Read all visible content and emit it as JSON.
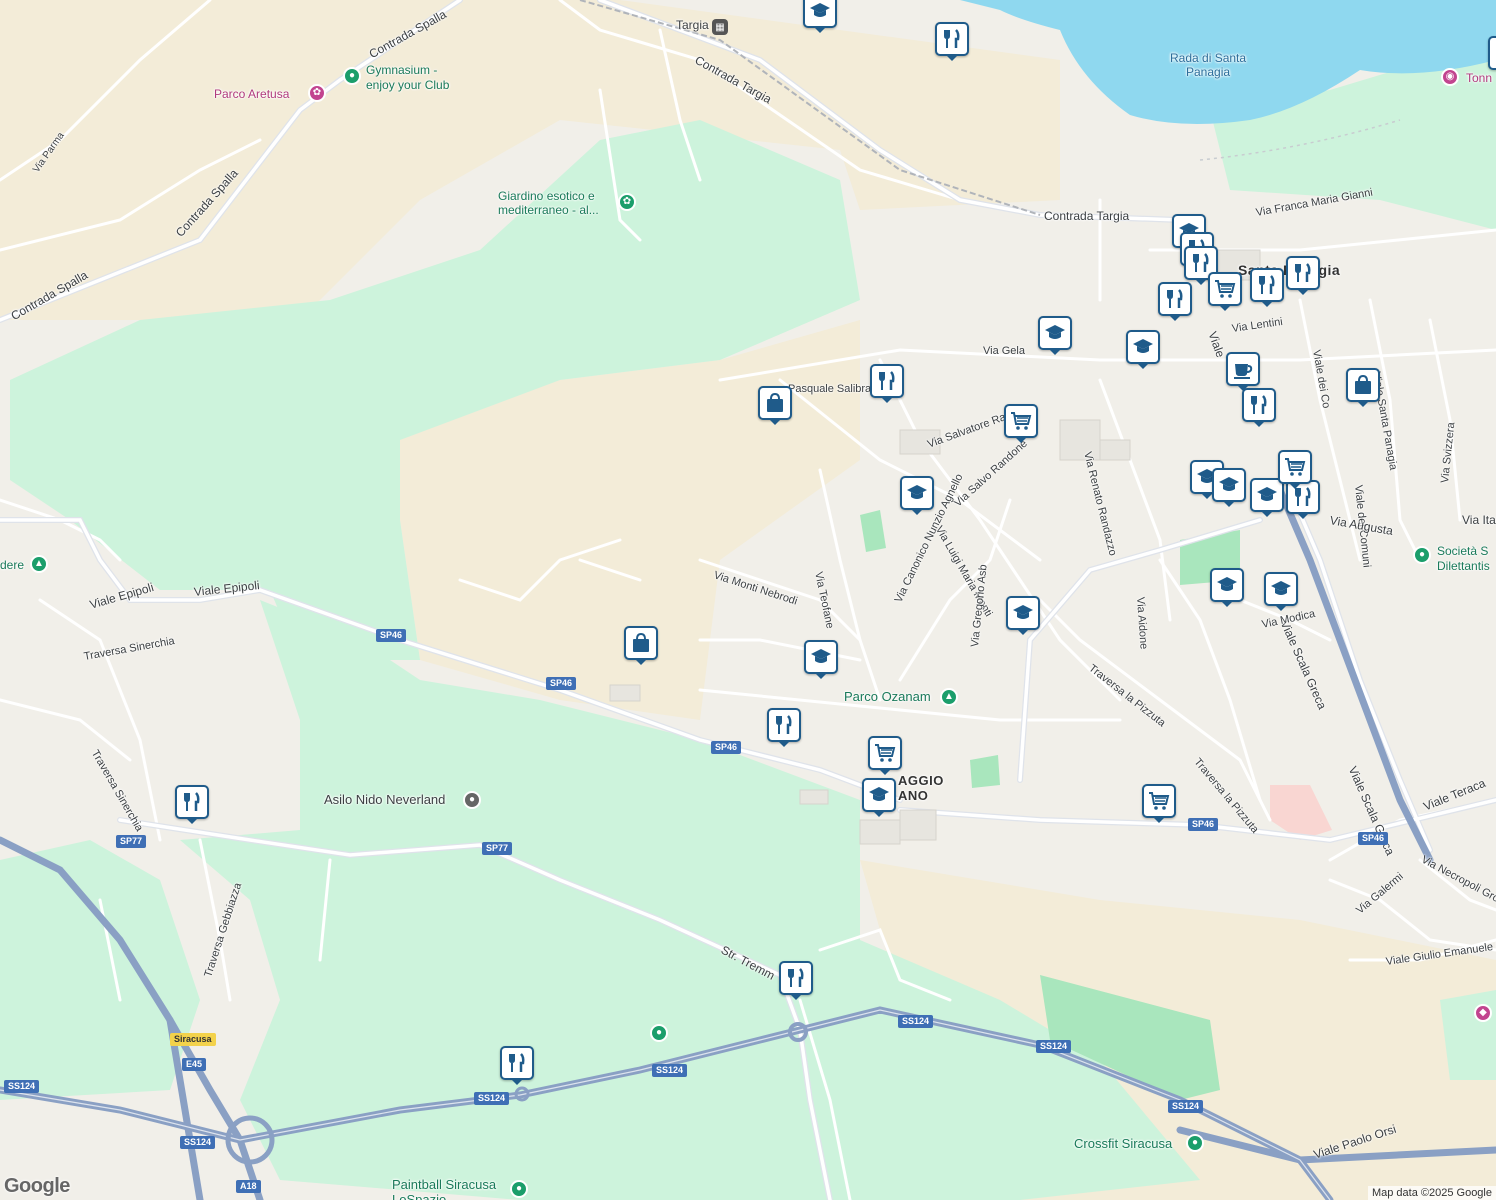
{
  "map": {
    "labels": {
      "parco_aretusa": "Parco Aretusa",
      "gymnasium": "Gymnasium -\nenjoy your Club",
      "contrada_spalla_1": "Contrada Spalla",
      "contrada_spalla_2": "Contrada Spalla",
      "contrada_spalla_3": "Contrada Spalla",
      "via_parma": "Via Parma",
      "targia": "Targia",
      "contrada_targia_1": "Contrada Targia",
      "contrada_targia_2": "Contrada Targia",
      "rada": "Rada di Santa\nPanagia",
      "tonn": "Tonn",
      "giardino": "Giardino esotico e\nmediterraneo - al...",
      "via_franca": "Via Franca Maria Gianni",
      "santa_panagia": "Santa Panagia",
      "via_lentini": "Via Lentini",
      "via_gela": "Via Gela",
      "viale_short": "Viale",
      "via_pasquale": "Pasquale Salibra",
      "via_salvatore": "Via Salvatore Ra",
      "via_salvo": "Via Salvo Randone",
      "via_renato": "Via Renato Randazzo",
      "viale_dei_co": "Viale dei Co",
      "viale_santa_panagia": "Viale Santa Panagia",
      "viale_dei_comuni": "Viale dei Comuni",
      "via_svizzera": "Via Svizzera",
      "via_ita": "Via Ita",
      "via_augusta": "Via Augusta",
      "societa": "Società S\nDilettantis",
      "via_luigi": "Via Luigi Maria Monti",
      "via_teofane": "Via Teofane",
      "via_monti_nebrodi": "Via Monti Nebrodi",
      "via_canonico": "Via Canonico Nunzio Agnello",
      "via_gregorio": "Via Gregorio Asb",
      "via_aidone": "Via Aidone",
      "viale_scala_greca_1": "Viale Scala Greca",
      "viale_scala_greca_2": "Viale Scala Greca",
      "via_modica": "Via Modica",
      "traversa_pizzuta_1": "Traversa la Pizzuta",
      "traversa_pizzuta_2": "Traversa la Pizzuta",
      "parco_ozanam": "Parco Ozanam",
      "villaggio": "AGGIO\nANO",
      "viale_teracati": "Viale Teraca",
      "via_necropoli": "Via Necropoli Gro",
      "via_galermi": "Via Galermi",
      "viale_giulio": "Viale Giulio Emanuele R",
      "viale_epipoli_1": "Viale Epipoli",
      "viale_epipoli_2": "Viale Epipoli",
      "traversa_sinerchia_1": "Traversa Sinerchia",
      "traversa_sinerchia_2": "Traversa Sinerchia",
      "belvedere": "dere",
      "asilo": "Asilo Nido Neverland",
      "traversa_gebbiazza": "Traversa Gebbiazza",
      "str_tremmi": "Str. Tremm",
      "crossfit": "Crossfit Siracusa",
      "viale_paolo_orsi": "Viale Paolo Orsi",
      "paintball": "Paintball Siracusa\nLoSpazio"
    },
    "shields": {
      "sp46_a": "SP46",
      "sp46_b": "SP46",
      "sp46_c": "SP46",
      "sp46_d": "SP46",
      "sp46_e": "SP46",
      "sp77_a": "SP77",
      "sp77_b": "SP77",
      "ss124_a": "SS124",
      "ss124_b": "SS124",
      "ss124_c": "SS124",
      "ss124_d": "SS124",
      "ss124_e": "SS124",
      "ss124_f": "SS124",
      "e45": "E45",
      "a18": "A18",
      "siracusa": "Siracusa"
    },
    "google_logo": "Google",
    "attribution": "Map data ©2025 Google",
    "colors": {
      "park": "#cdf3dc",
      "land": "#f1efe9",
      "sand": "#f3ecd8",
      "water": "#8fd8ef",
      "highway": "#8aa0c4",
      "road": "#ffffff",
      "pin_border": "#1f5b8a"
    }
  }
}
